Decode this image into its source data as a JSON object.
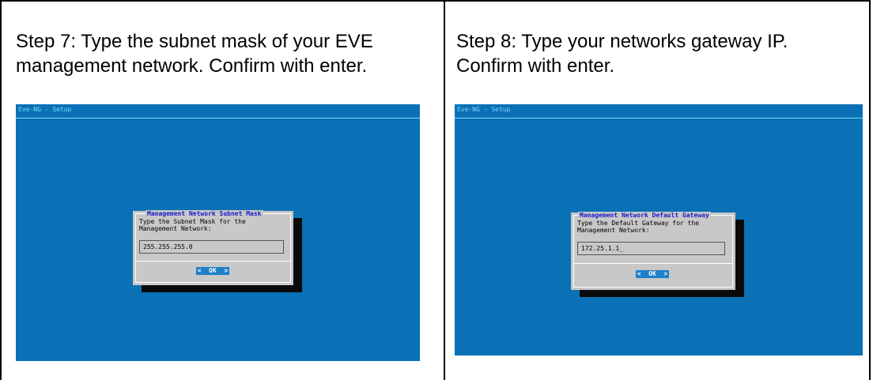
{
  "steps": [
    {
      "caption_line1": "Step 7: Type the subnet mask of your EVE",
      "caption_line2": "management network. Confirm with enter.",
      "window_title": "Eve-NG - Setup",
      "dialog_title": "Management Network Subnet Mask",
      "prompt": "Type the Subnet Mask for the\nManagement Network:",
      "input_value": "255.255.255.0",
      "ok_label": "<  OK  >"
    },
    {
      "caption_line1": "Step 8: Type your networks gateway IP.",
      "caption_line2": "Confirm with enter.",
      "window_title": "Eve-NG - Setup",
      "dialog_title": "Management Network Default Gateway",
      "prompt": "Type the Default Gateway for the\nManagement Network:",
      "input_value": "172.25.1.1_",
      "ok_label": "<  OK  >"
    }
  ],
  "colors": {
    "terminal_background": "#0b71b6",
    "dialog_background": "#c8c8c8",
    "dialog_title": "#1a1acc",
    "ok_button": "#1f7fc9"
  }
}
